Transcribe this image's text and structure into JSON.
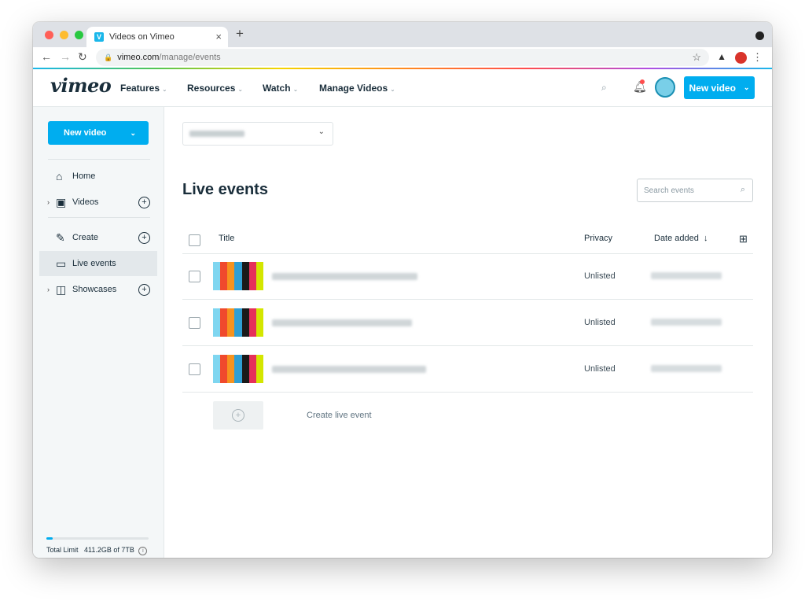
{
  "browser": {
    "tab_title": "Videos on Vimeo",
    "favicon_letter": "V",
    "close_glyph": "×",
    "new_tab_glyph": "+",
    "url_host": "vimeo.com",
    "url_path": "/manage/events",
    "back_glyph": "←",
    "forward_glyph": "→",
    "reload_glyph": "↻",
    "lock_glyph": "🔒",
    "star_glyph": "☆",
    "menu_glyph": "⋮"
  },
  "header": {
    "logo": "vimeo",
    "nav": [
      {
        "label": "Features"
      },
      {
        "label": "Resources"
      },
      {
        "label": "Watch"
      },
      {
        "label": "Manage Videos"
      }
    ],
    "new_video_label": "New video"
  },
  "sidebar": {
    "new_video_label": "New video",
    "items": [
      {
        "label": "Home",
        "icon": "home-icon"
      },
      {
        "label": "Videos",
        "icon": "video-library-icon"
      },
      {
        "label": "Create",
        "icon": "create-icon"
      },
      {
        "label": "Live events",
        "icon": "camera-icon"
      },
      {
        "label": "Showcases",
        "icon": "showcase-icon"
      }
    ],
    "storage": {
      "label": "Total Limit",
      "value": "411.2GB of 7TB",
      "used_fraction": 0.06
    }
  },
  "main": {
    "title": "Live events",
    "search_placeholder": "Search events",
    "columns": {
      "title": "Title",
      "privacy": "Privacy",
      "date_added": "Date added"
    },
    "rows": [
      {
        "privacy": "Unlisted"
      },
      {
        "privacy": "Unlisted"
      },
      {
        "privacy": "Unlisted"
      }
    ],
    "create_label": "Create live event"
  },
  "colors": {
    "accent": "#00adef",
    "text": "#1a2e3b",
    "sidebar_bg": "#f4f7f8",
    "thumb_bars": [
      "#7fd6f0",
      "#f04a2d",
      "#f7931e",
      "#2f9fd4",
      "#1a1a1a",
      "#e6305a",
      "#d4e600"
    ]
  }
}
